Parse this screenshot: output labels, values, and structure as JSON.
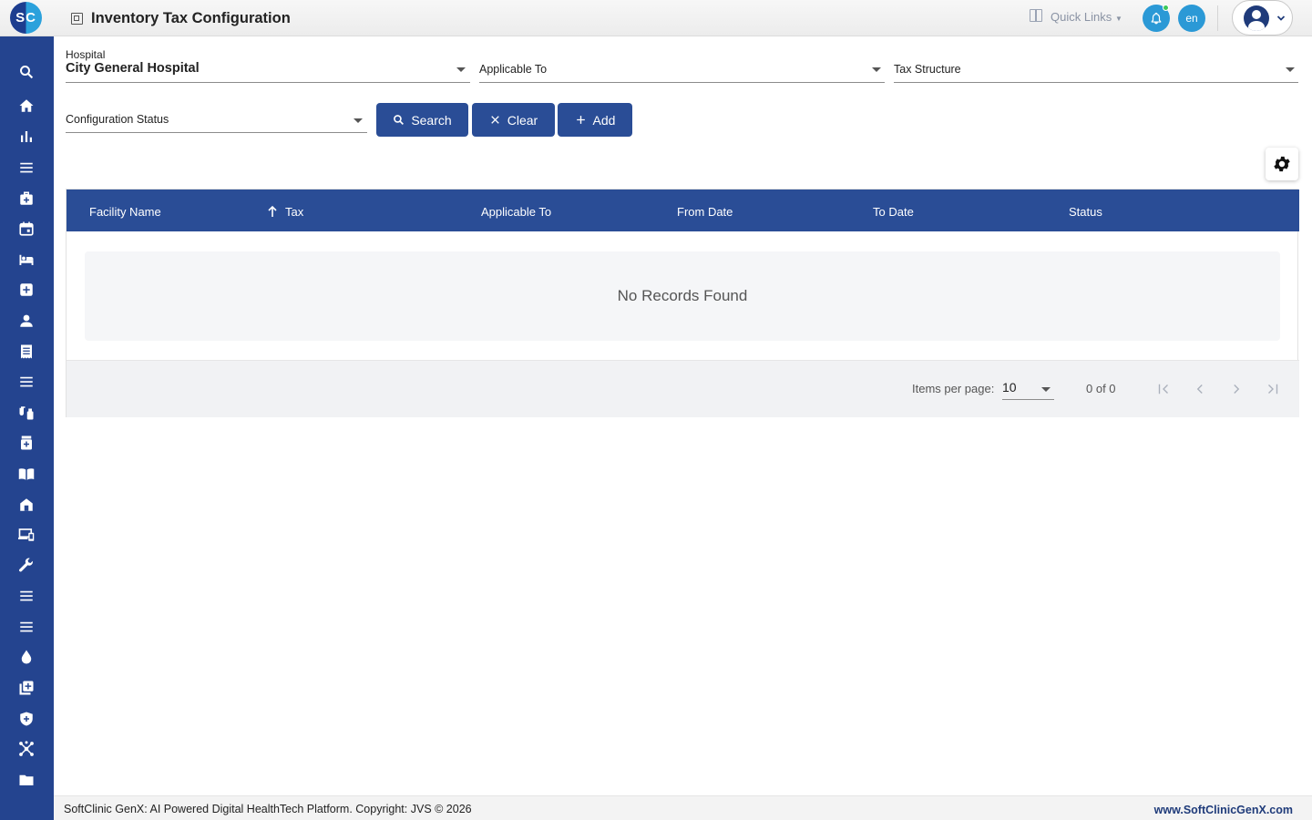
{
  "app": {
    "logo_text": "SC",
    "page_title": "Inventory Tax Configuration",
    "quick_links_label": "Quick Links",
    "lang_label": "en"
  },
  "sidebar": {
    "items": [
      {
        "name": "search-icon"
      },
      {
        "name": "home-icon"
      },
      {
        "name": "bar-chart-icon"
      },
      {
        "name": "menu-icon"
      },
      {
        "name": "medical-bag-icon"
      },
      {
        "name": "calendar-icon"
      },
      {
        "name": "bed-icon"
      },
      {
        "name": "medical-plus-icon"
      },
      {
        "name": "person-icon"
      },
      {
        "name": "receipt-icon"
      },
      {
        "name": "menu-icon"
      },
      {
        "name": "lab-icon"
      },
      {
        "name": "medicine-bottle-icon"
      },
      {
        "name": "book-icon"
      },
      {
        "name": "store-icon"
      },
      {
        "name": "devices-icon"
      },
      {
        "name": "wrench-icon"
      },
      {
        "name": "menu-icon"
      },
      {
        "name": "menu-icon"
      },
      {
        "name": "drop-icon"
      },
      {
        "name": "add-library-icon"
      },
      {
        "name": "shield-icon"
      },
      {
        "name": "hub-icon"
      },
      {
        "name": "folder-icon"
      }
    ]
  },
  "filters": {
    "hospital_label": "Hospital",
    "hospital_value": "City General Hospital",
    "applicable_to_placeholder": "Applicable To",
    "tax_structure_placeholder": "Tax Structure",
    "config_status_placeholder": "Configuration Status"
  },
  "buttons": {
    "search_label": "Search",
    "clear_label": "Clear",
    "add_label": "Add"
  },
  "table": {
    "columns": [
      "Facility Name",
      "Tax",
      "Applicable To",
      "From Date",
      "To Date",
      "Status"
    ],
    "empty_message": "No Records Found"
  },
  "paginator": {
    "items_per_page_label": "Items per page:",
    "items_per_page_value": "10",
    "range_label": "0 of 0"
  },
  "footer": {
    "copyright": "SoftClinic GenX: AI Powered Digital HealthTech Platform. Copyright: JVS © 2026",
    "website": "www.SoftClinicGenX.com"
  },
  "colors": {
    "primary": "#2a4d96",
    "sidebar": "#24448f",
    "accent": "#2b99d6"
  }
}
